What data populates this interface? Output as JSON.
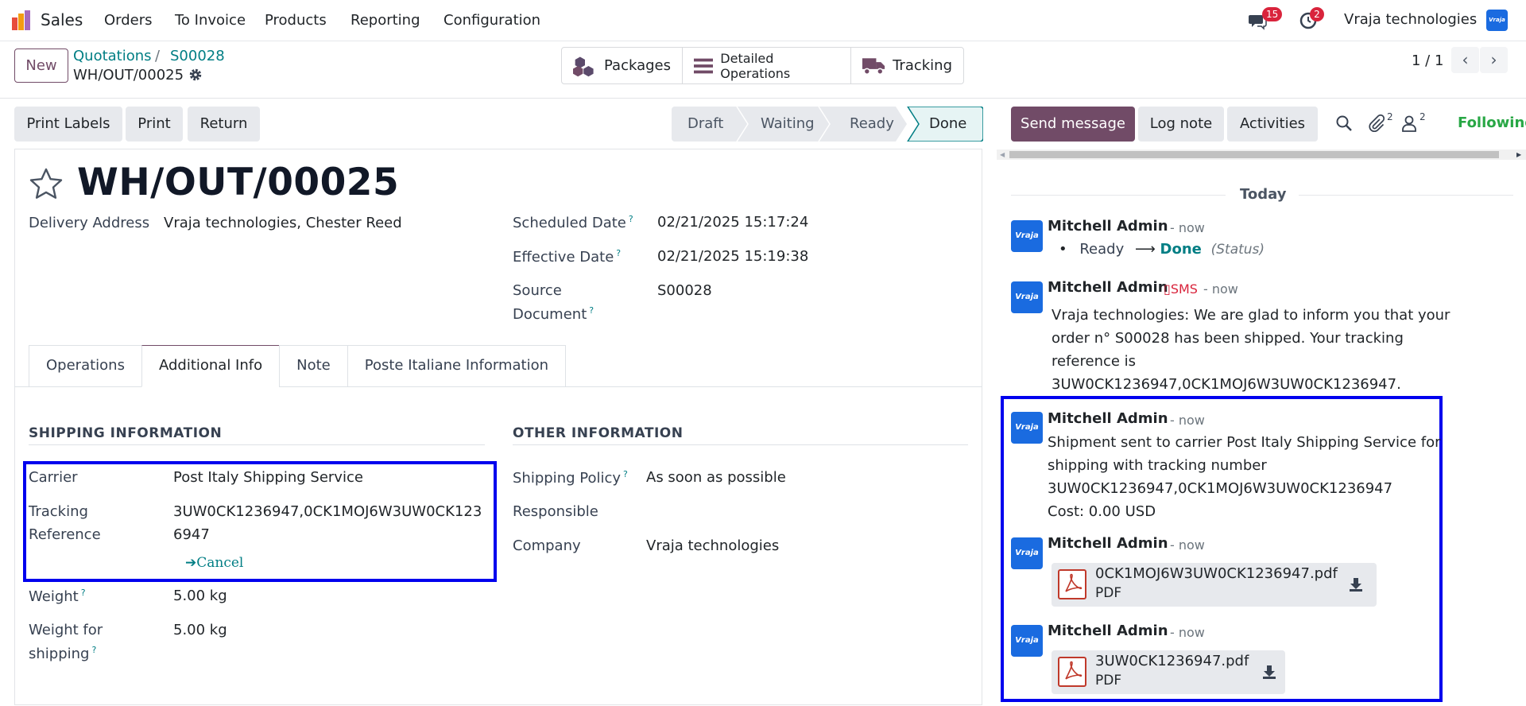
{
  "nav": {
    "app": "Sales",
    "menus": [
      "Orders",
      "To Invoice",
      "Products",
      "Reporting",
      "Configuration"
    ],
    "messages_count": "15",
    "activities_count": "2",
    "company": "Vraja technologies",
    "avatar_text": "Vraja"
  },
  "control": {
    "new_label": "New",
    "breadcrumb": [
      "Quotations",
      "S00028"
    ],
    "breadcrumb_sep": "/",
    "record": "WH/OUT/00025",
    "smart_buttons": [
      "Packages",
      "Detailed Operations",
      "Tracking"
    ],
    "pager": "1 / 1"
  },
  "actions": {
    "print_labels": "Print Labels",
    "print": "Print",
    "return": "Return"
  },
  "status": {
    "steps": [
      "Draft",
      "Waiting",
      "Ready",
      "Done"
    ],
    "current": "Done"
  },
  "form": {
    "title": "WH/OUT/00025",
    "delivery_address_label": "Delivery Address",
    "delivery_address": "Vraja technologies, Chester Reed",
    "scheduled_label": "Scheduled Date",
    "scheduled": "02/21/2025 15:17:24",
    "effective_label": "Effective Date",
    "effective": "02/21/2025 15:19:38",
    "source_label_1": "Source",
    "source_label_2": "Document",
    "source": "S00028",
    "tabs": [
      "Operations",
      "Additional Info",
      "Note",
      "Poste Italiane Information"
    ],
    "active_tab": "Additional Info",
    "shipping_title": "SHIPPING INFORMATION",
    "other_title": "OTHER INFORMATION",
    "carrier_label": "Carrier",
    "carrier": "Post Italy Shipping Service",
    "tracking_label_1": "Tracking",
    "tracking_label_2": "Reference",
    "tracking_1": "3UW0CK1236947,0CK1MOJ6W3UW0CK123",
    "tracking_2": "6947",
    "cancel": "Cancel",
    "weight_label": "Weight",
    "weight": "5.00 kg",
    "weight_ship_label_1": "Weight for",
    "weight_ship_label_2": "shipping",
    "weight_ship": "5.00 kg",
    "policy_label": "Shipping Policy",
    "policy": "As soon as possible",
    "responsible_label": "Responsible",
    "company_label": "Company",
    "company": "Vraja technologies",
    "help_mark": "?"
  },
  "chatter": {
    "send_message": "Send message",
    "log_note": "Log note",
    "activities": "Activities",
    "attachments_count": "2",
    "followers_count": "2",
    "following": "Following",
    "today": "Today",
    "messages": [
      {
        "author": "Mitchell Admin",
        "date": "- now",
        "from": "Ready",
        "to": "Done",
        "field": "(Status)"
      },
      {
        "author": "Mitchell Admin",
        "sms": "SMS",
        "date": "- now",
        "lines": [
          "Vraja technologies: We are glad to inform you that your",
          "order n° S00028 has been shipped. Your tracking",
          "reference is",
          "3UW0CK1236947,0CK1MOJ6W3UW0CK1236947."
        ]
      },
      {
        "author": "Mitchell Admin",
        "date": "- now",
        "lines": [
          "Shipment sent to carrier Post Italy Shipping Service for",
          "shipping with tracking number",
          "3UW0CK1236947,0CK1MOJ6W3UW0CK1236947",
          "Cost: 0.00 USD"
        ]
      },
      {
        "author": "Mitchell Admin",
        "date": "- now",
        "attachment": "0CK1MOJ6W3UW0CK1236947.pdf",
        "type": "PDF"
      },
      {
        "author": "Mitchell Admin",
        "date": "- now",
        "attachment": "3UW0CK1236947.pdf",
        "type": "PDF"
      }
    ]
  },
  "colors": {
    "primary": "#714b67",
    "link": "#017e84",
    "highlight": "#0000ee",
    "following": "#28a745"
  }
}
